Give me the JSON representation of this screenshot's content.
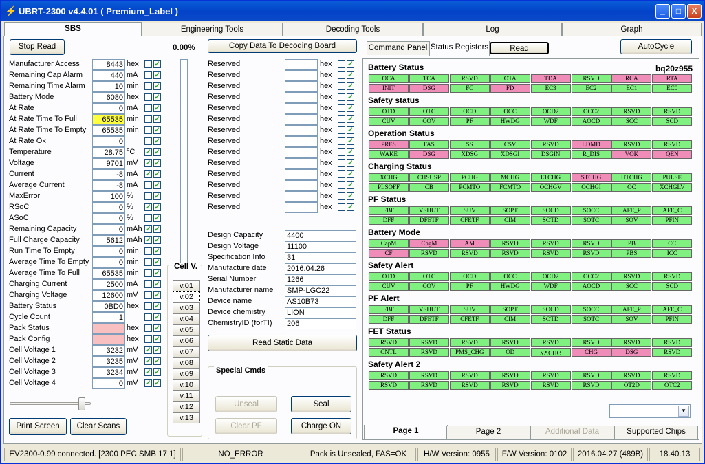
{
  "window": {
    "title": "UBRT-2300 v4.4.01  ( Premium_Label )",
    "min": "_",
    "max": "□",
    "close": "X"
  },
  "main_tabs": [
    {
      "label": "SBS"
    },
    {
      "label": "Engineering Tools"
    },
    {
      "label": "Decoding Tools"
    },
    {
      "label": "Log"
    },
    {
      "label": "Graph"
    }
  ],
  "sbs": {
    "stop_read": "Stop Read",
    "percent": "0.00%",
    "copy_btn": "Copy Data To Decoding Board",
    "print_screen": "Print Screen",
    "clear_scans": "Clear Scans",
    "rows": [
      {
        "label": "Manufacturer Access",
        "value": "8443",
        "unit": "hex",
        "c1": false,
        "c2": true
      },
      {
        "label": "Remaining Cap Alarm",
        "value": "440",
        "unit": "mA",
        "c1": false,
        "c2": true
      },
      {
        "label": "Remaining Time Alarm",
        "value": "10",
        "unit": "min",
        "c1": false,
        "c2": true
      },
      {
        "label": "Battery Mode",
        "value": "6080",
        "unit": "hex",
        "c1": false,
        "c2": true
      },
      {
        "label": "At Rate",
        "value": "0",
        "unit": "mA",
        "c1": false,
        "c2": true
      },
      {
        "label": "At Rate Time To Full",
        "value": "65535",
        "unit": "min",
        "c1": false,
        "c2": true,
        "hl": "#ffff40"
      },
      {
        "label": "At Rate Time To Empty",
        "value": "65535",
        "unit": "min",
        "c1": false,
        "c2": true
      },
      {
        "label": "At Rate Ok",
        "value": "0",
        "unit": "",
        "c1": false,
        "c2": true
      },
      {
        "label": "Temperature",
        "value": "28.75",
        "unit": "°C",
        "c1": true,
        "c2": true
      },
      {
        "label": "Voltage",
        "value": "9701",
        "unit": "mV",
        "c1": true,
        "c2": true
      },
      {
        "label": "Current",
        "value": "-8",
        "unit": "mA",
        "c1": true,
        "c2": true
      },
      {
        "label": "Average Current",
        "value": "-8",
        "unit": "mA",
        "c1": false,
        "c2": true
      },
      {
        "label": "MaxError",
        "value": "100",
        "unit": "%",
        "c1": false,
        "c2": true
      },
      {
        "label": "RSoC",
        "value": "0",
        "unit": "%",
        "c1": true,
        "c2": true
      },
      {
        "label": "ASoC",
        "value": "0",
        "unit": "%",
        "c1": false,
        "c2": true
      },
      {
        "label": "Remaining Capacity",
        "value": "0",
        "unit": "mAh",
        "c1": true,
        "c2": true
      },
      {
        "label": "Full Charge Capacity",
        "value": "5612",
        "unit": "mAh",
        "c1": true,
        "c2": true
      },
      {
        "label": "Run Time To Empty",
        "value": "0",
        "unit": "min",
        "c1": false,
        "c2": true
      },
      {
        "label": "Average Time To Empty",
        "value": "0",
        "unit": "min",
        "c1": false,
        "c2": true
      },
      {
        "label": "Average Time To Full",
        "value": "65535",
        "unit": "min",
        "c1": false,
        "c2": true
      },
      {
        "label": "Charging Current",
        "value": "2500",
        "unit": "mA",
        "c1": false,
        "c2": true
      },
      {
        "label": "Charging Voltage",
        "value": "12600",
        "unit": "mV",
        "c1": false,
        "c2": true
      },
      {
        "label": "Battery Status",
        "value": "0BD0",
        "unit": "hex",
        "c1": false,
        "c2": true
      },
      {
        "label": "Cycle Count",
        "value": "1",
        "unit": "",
        "c1": false,
        "c2": true
      },
      {
        "label": "Pack Status",
        "value": "",
        "unit": "hex",
        "c1": false,
        "c2": true,
        "hl": "#f8c0c0"
      },
      {
        "label": "Pack Config",
        "value": "",
        "unit": "hex",
        "c1": false,
        "c2": true,
        "hl": "#f8c0c0"
      },
      {
        "label": "Cell Voltage 1",
        "value": "3232",
        "unit": "mV",
        "c1": true,
        "c2": true
      },
      {
        "label": "Cell Voltage 2",
        "value": "3235",
        "unit": "mV",
        "c1": true,
        "c2": true
      },
      {
        "label": "Cell Voltage 3",
        "value": "3234",
        "unit": "mV",
        "c1": true,
        "c2": true
      },
      {
        "label": "Cell Voltage 4",
        "value": "0",
        "unit": "mV",
        "c1": true,
        "c2": true
      }
    ],
    "reserved": [
      {
        "label": "Reserved",
        "unit": "hex"
      },
      {
        "label": "Reserved",
        "unit": "hex"
      },
      {
        "label": "Reserved",
        "unit": "hex"
      },
      {
        "label": "Reserved",
        "unit": "hex"
      },
      {
        "label": "Reserved",
        "unit": "hex"
      },
      {
        "label": "Reserved",
        "unit": "hex"
      },
      {
        "label": "Reserved",
        "unit": "hex"
      },
      {
        "label": "Reserved",
        "unit": "hex"
      },
      {
        "label": "Reserved",
        "unit": "hex"
      },
      {
        "label": "Reserved",
        "unit": "hex"
      },
      {
        "label": "Reserved",
        "unit": "hex"
      },
      {
        "label": "Reserved",
        "unit": "hex"
      },
      {
        "label": "Reserved",
        "unit": "hex"
      },
      {
        "label": "Reserved",
        "unit": "hex"
      }
    ],
    "cellv_label": "Cell V.",
    "cellv": [
      "v.01",
      "v.02",
      "v.03",
      "v.04",
      "v.05",
      "v.06",
      "v.07",
      "v.08",
      "v.09",
      "v.10",
      "v.11",
      "v.12",
      "v.13"
    ],
    "static_info": [
      {
        "label": "Design Capacity",
        "value": "4400"
      },
      {
        "label": "Design Voltage",
        "value": "11100"
      },
      {
        "label": "Specification Info",
        "value": "31"
      },
      {
        "label": "Manufacture date",
        "value": "2016.04.26"
      },
      {
        "label": "Serial Number",
        "value": "1266"
      },
      {
        "label": "Manufacturer name",
        "value": "SMP-LGC22"
      },
      {
        "label": "Device name",
        "value": "AS10B73"
      },
      {
        "label": "Device chemistry",
        "value": "LION"
      },
      {
        "label": "ChemistryID (forTI)",
        "value": "206"
      }
    ],
    "read_static": "Read Static Data",
    "special_cmds": {
      "title": "Special Cmds",
      "unseal": "Unseal",
      "seal": "Seal",
      "clear_pf": "Clear PF",
      "charge_on": "Charge ON"
    }
  },
  "regs": {
    "tabs": [
      {
        "label": "Command Panel"
      },
      {
        "label": "Status Registers"
      }
    ],
    "read_btn": "Read",
    "autocycle": "AutoCycle",
    "chip": "bq20z955",
    "sections": [
      {
        "title": "Battery Status",
        "bits": [
          [
            "OCA",
            "g"
          ],
          [
            "TCA",
            "g"
          ],
          [
            "RSVD",
            "g"
          ],
          [
            "OTA",
            "g"
          ],
          [
            "TDA",
            "p"
          ],
          [
            "RSVD",
            "g"
          ],
          [
            "RCA",
            "p"
          ],
          [
            "RTA",
            "p"
          ],
          [
            "INIT",
            "p"
          ],
          [
            "DSG",
            "p"
          ],
          [
            "FC",
            "g"
          ],
          [
            "FD",
            "p"
          ],
          [
            "EC3",
            "g"
          ],
          [
            "EC2",
            "g"
          ],
          [
            "EC1",
            "g"
          ],
          [
            "EC0",
            "g"
          ]
        ]
      },
      {
        "title": "Safety status",
        "bits": [
          [
            "OTD",
            "g"
          ],
          [
            "OTC",
            "g"
          ],
          [
            "OCD",
            "g"
          ],
          [
            "OCC",
            "g"
          ],
          [
            "OCD2",
            "g"
          ],
          [
            "OCC2",
            "g"
          ],
          [
            "RSVD",
            "g"
          ],
          [
            "RSVD",
            "g"
          ],
          [
            "CUV",
            "g"
          ],
          [
            "COV",
            "g"
          ],
          [
            "PF",
            "g"
          ],
          [
            "HWDG",
            "g"
          ],
          [
            "WDF",
            "g"
          ],
          [
            "AOCD",
            "g"
          ],
          [
            "SCC",
            "g"
          ],
          [
            "SCD",
            "g"
          ]
        ]
      },
      {
        "title": "Operation Status",
        "bits": [
          [
            "PRES",
            "p"
          ],
          [
            "FAS",
            "g"
          ],
          [
            "SS",
            "g"
          ],
          [
            "CSV",
            "g"
          ],
          [
            "RSVD",
            "g"
          ],
          [
            "LDMD",
            "p"
          ],
          [
            "RSVD",
            "g"
          ],
          [
            "RSVD",
            "g"
          ],
          [
            "WAKE",
            "g"
          ],
          [
            "DSG",
            "p"
          ],
          [
            "XDSG",
            "g"
          ],
          [
            "XDSGI",
            "g"
          ],
          [
            "DSGIN",
            "g"
          ],
          [
            "R_DIS",
            "g"
          ],
          [
            "VOK",
            "p"
          ],
          [
            "QEN",
            "p"
          ]
        ]
      },
      {
        "title": "Charging Status",
        "bits": [
          [
            "XCHG",
            "g"
          ],
          [
            "CHSUSP",
            "g"
          ],
          [
            "PCHG",
            "g"
          ],
          [
            "MCHG",
            "g"
          ],
          [
            "LTCHG",
            "g"
          ],
          [
            "STCHG",
            "p"
          ],
          [
            "HTCHG",
            "g"
          ],
          [
            "PULSE",
            "g"
          ],
          [
            "PLSOFF",
            "g"
          ],
          [
            "CB",
            "g"
          ],
          [
            "PCMTO",
            "g"
          ],
          [
            "FCMTO",
            "g"
          ],
          [
            "OCHGV",
            "g"
          ],
          [
            "OCHGI",
            "g"
          ],
          [
            "OC",
            "g"
          ],
          [
            "XCHGLV",
            "g"
          ]
        ]
      },
      {
        "title": "PF Status",
        "bits": [
          [
            "FBF",
            "g"
          ],
          [
            "VSHUT",
            "g"
          ],
          [
            "SUV",
            "g"
          ],
          [
            "SOPT",
            "g"
          ],
          [
            "SOCD",
            "g"
          ],
          [
            "SOCC",
            "g"
          ],
          [
            "AFE_P",
            "g"
          ],
          [
            "AFE_C",
            "g"
          ],
          [
            "DFF",
            "g"
          ],
          [
            "DFETF",
            "g"
          ],
          [
            "CFETF",
            "g"
          ],
          [
            "CIM",
            "g"
          ],
          [
            "SOTD",
            "g"
          ],
          [
            "SOTC",
            "g"
          ],
          [
            "SOV",
            "g"
          ],
          [
            "PFIN",
            "g"
          ]
        ]
      },
      {
        "title": "Battery Mode",
        "bits": [
          [
            "CapM",
            "g"
          ],
          [
            "ChgM",
            "p"
          ],
          [
            "AM",
            "p"
          ],
          [
            "RSVD",
            "g"
          ],
          [
            "RSVD",
            "g"
          ],
          [
            "RSVD",
            "g"
          ],
          [
            "PB",
            "g"
          ],
          [
            "CC",
            "g"
          ],
          [
            "CF",
            "p"
          ],
          [
            "RSVD",
            "g"
          ],
          [
            "RSVD",
            "g"
          ],
          [
            "RSVD",
            "g"
          ],
          [
            "RSVD",
            "g"
          ],
          [
            "RSVD",
            "g"
          ],
          [
            "PBS",
            "g"
          ],
          [
            "ICC",
            "g"
          ]
        ]
      },
      {
        "title": "Safety Alert",
        "bits": [
          [
            "OTD",
            "g"
          ],
          [
            "OTC",
            "g"
          ],
          [
            "OCD",
            "g"
          ],
          [
            "OCC",
            "g"
          ],
          [
            "OCD2",
            "g"
          ],
          [
            "OCC2",
            "g"
          ],
          [
            "RSVD",
            "g"
          ],
          [
            "RSVD",
            "g"
          ],
          [
            "CUV",
            "g"
          ],
          [
            "COV",
            "g"
          ],
          [
            "PF",
            "g"
          ],
          [
            "HWDG",
            "g"
          ],
          [
            "WDF",
            "g"
          ],
          [
            "AOCD",
            "g"
          ],
          [
            "SCC",
            "g"
          ],
          [
            "SCD",
            "g"
          ]
        ]
      },
      {
        "title": "PF Alert",
        "bits": [
          [
            "FBF",
            "g"
          ],
          [
            "VSHUT",
            "g"
          ],
          [
            "SUV",
            "g"
          ],
          [
            "SOPT",
            "g"
          ],
          [
            "SOCD",
            "g"
          ],
          [
            "SOCC",
            "g"
          ],
          [
            "AFE_P",
            "g"
          ],
          [
            "AFE_C",
            "g"
          ],
          [
            "DFF",
            "g"
          ],
          [
            "DFETF",
            "g"
          ],
          [
            "CFETF",
            "g"
          ],
          [
            "CIM",
            "g"
          ],
          [
            "SOTD",
            "g"
          ],
          [
            "SOTC",
            "g"
          ],
          [
            "SOV",
            "g"
          ],
          [
            "PFIN",
            "g"
          ]
        ]
      },
      {
        "title": "FET Status",
        "bits": [
          [
            "RSVD",
            "g"
          ],
          [
            "RSVD",
            "g"
          ],
          [
            "RSVD",
            "g"
          ],
          [
            "RSVD",
            "g"
          ],
          [
            "RSVD",
            "g"
          ],
          [
            "RSVD",
            "g"
          ],
          [
            "RSVD",
            "g"
          ],
          [
            "RSVD",
            "g"
          ],
          [
            "CNTL",
            "g"
          ],
          [
            "RSVD",
            "g"
          ],
          [
            "PMS_CHG",
            "g"
          ],
          [
            "OD",
            "g"
          ],
          [
            "ZVCHG",
            "g",
            "flip"
          ],
          [
            "CHG",
            "p"
          ],
          [
            "DSG",
            "p"
          ],
          [
            "RSVD",
            "g"
          ]
        ]
      },
      {
        "title": "Safety Alert 2",
        "bits": [
          [
            "RSVD",
            "g"
          ],
          [
            "RSVD",
            "g"
          ],
          [
            "RSVD",
            "g"
          ],
          [
            "RSVD",
            "g"
          ],
          [
            "RSVD",
            "g"
          ],
          [
            "RSVD",
            "g"
          ],
          [
            "RSVD",
            "g"
          ],
          [
            "RSVD",
            "g"
          ],
          [
            "RSVD",
            "g"
          ],
          [
            "RSVD",
            "g"
          ],
          [
            "RSVD",
            "g"
          ],
          [
            "RSVD",
            "g"
          ],
          [
            "RSVD",
            "g"
          ],
          [
            "RSVD",
            "g"
          ],
          [
            "OT2D",
            "g"
          ],
          [
            "OTC2",
            "g"
          ]
        ]
      }
    ],
    "page_tabs": [
      {
        "label": "Page 1"
      },
      {
        "label": "Page 2"
      },
      {
        "label": "Additional Data"
      },
      {
        "label": "Supported Chips"
      }
    ]
  },
  "statusbar": [
    "EV2300-0.99 connected. [2300  PEC  SMB  17 1]",
    "NO_ERROR",
    "Pack is Unsealed, FAS=OK",
    "H/W Version: 0955",
    "F/W Version: 0102",
    "2016.04.27  (489B)",
    "18.40.13"
  ],
  "colors": {
    "bit_set": "#f08cb8",
    "bit_clear": "#80f080",
    "title_bar": "#0343c9"
  },
  "icons": {
    "app": "battery-icon",
    "dropdown": "chevron-down-icon"
  }
}
